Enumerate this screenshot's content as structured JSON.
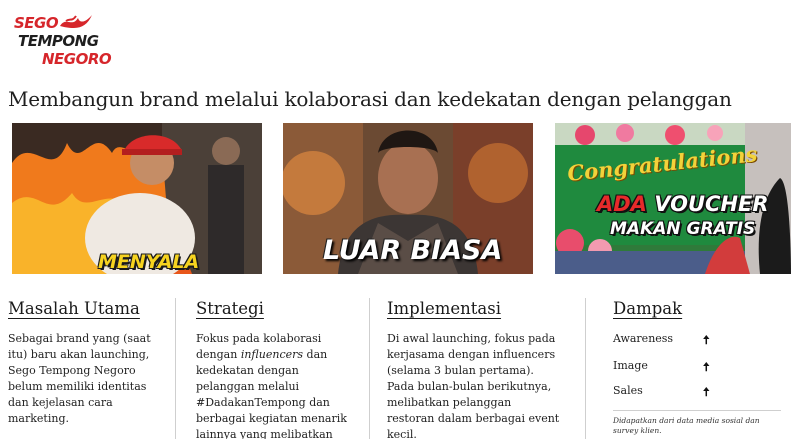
{
  "logo": {
    "line1": "SEGO",
    "line2": "TEMPONG",
    "line3": "NEGORO",
    "icon": "flame-icon"
  },
  "headline": "Membangun brand melalui kolaborasi dan kedekatan dengan pelanggan",
  "photos": [
    {
      "caption": "MENYALA"
    },
    {
      "caption": "LUAR BIASA"
    },
    {
      "banner": "Congratulations",
      "caption_accent": "ADA",
      "caption_rest": " VOUCHER",
      "caption_line2": "MAKAN GRATIS"
    }
  ],
  "columns": {
    "masalah": {
      "title": "Masalah Utama",
      "body": "Sebagai brand yang (saat itu) baru akan launching, Sego Tempong Negoro belum memiliki identitas dan kejelasan cara marketing."
    },
    "strategi": {
      "title": "Strategi",
      "body_pre": "Fokus pada kolaborasi dengan ",
      "body_em": "influencers",
      "body_post": " dan kedekatan dengan pelanggan melalui #DadakanTempong dan berbagai kegiatan menarik lainnya yang melibatkan pelanggan."
    },
    "implementasi": {
      "title": "Implementasi",
      "body": "Di awal launching, fokus pada kerjasama dengan influencers (selama 3 bulan pertama). Pada bulan-bulan berikutnya, melibatkan pelanggan restoran dalam berbagai event kecil."
    },
    "dampak": {
      "title": "Dampak",
      "items": [
        {
          "label": "Awareness",
          "arrow": "🠅",
          "icon": "arrow-up-icon"
        },
        {
          "label": "Image",
          "arrow": "🠅",
          "icon": "arrow-up-icon"
        },
        {
          "label": "Sales",
          "arrow": "🠅",
          "icon": "arrow-up-icon"
        }
      ],
      "footnote": "Didapatkan dari data media sosial dan survey klien."
    }
  },
  "colors": {
    "brand_red": "#d6262b",
    "text": "#1c1c1c",
    "divider": "#cfcfcf",
    "caption_yellow": "#f6d31f"
  }
}
